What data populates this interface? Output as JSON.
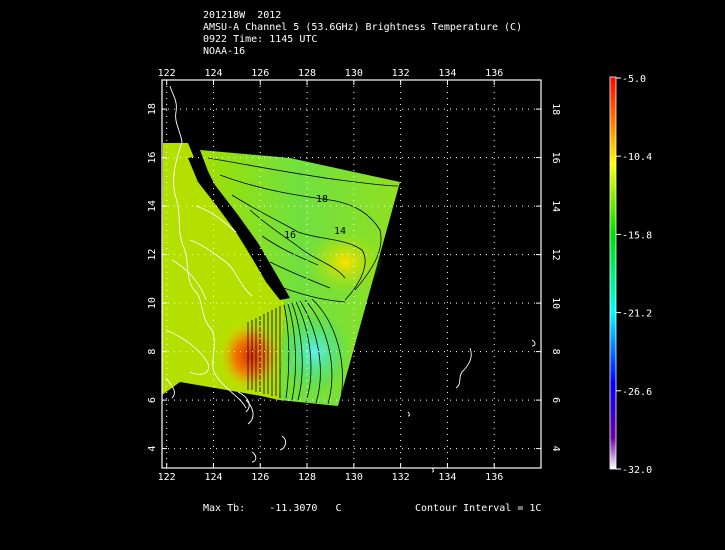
{
  "header": {
    "storm_id": "201218W  2012",
    "product": "AMSU-A Channel 5 (53.6GHz) Brightness Temperature (C)",
    "time": "0922 Time: 1145 UTC",
    "satellite": "NOAA-16"
  },
  "axes": {
    "lon_ticks": [
      "122",
      "124",
      "126",
      "128",
      "130",
      "132",
      "134",
      "136"
    ],
    "lat_ticks": [
      "18",
      "16",
      "14",
      "12",
      "10",
      "8",
      "6",
      "4"
    ],
    "lon_range": [
      121.8,
      138.0
    ],
    "lat_range": [
      3.2,
      19.2
    ]
  },
  "colorbar": {
    "labels": [
      "-5.0",
      "-10.4",
      "-15.8",
      "-21.2",
      "-26.6",
      "-32.0"
    ],
    "range": [
      -32.0,
      -5.0
    ]
  },
  "contour_labels": [
    "18",
    "16",
    "14"
  ],
  "footer": {
    "max_tb_label": "Max Tb:",
    "max_tb_value": "-11.3070",
    "max_tb_unit": "C",
    "contour_interval": "Contour Interval = 1C"
  },
  "colors": {
    "background": "#000000",
    "frame": "#ffffff"
  }
}
